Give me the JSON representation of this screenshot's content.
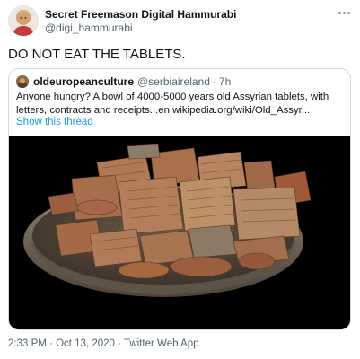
{
  "tweet": {
    "display_name": "Secret Freemason Digital Hammurabi",
    "handle": "@digi_hammurabi",
    "text": "DO NOT EAT THE TABLETS."
  },
  "quote": {
    "display_name": "oldeuropeanculture",
    "handle": "@serbiaireland",
    "separator": "·",
    "time": "7h",
    "text": "Anyone hungry? A bowl of 4000-5000 years old Assyrian tablets, with letters, contracts and receipts...en.wikipedia.org/wiki/Old_Assyr...",
    "show_thread": "Show this thread"
  },
  "meta": {
    "time": "2:33 PM",
    "separator": "·",
    "date": "Oct 13, 2020",
    "source": "Twitter Web App"
  },
  "icons": {
    "more": "more-horizontal-icon"
  }
}
